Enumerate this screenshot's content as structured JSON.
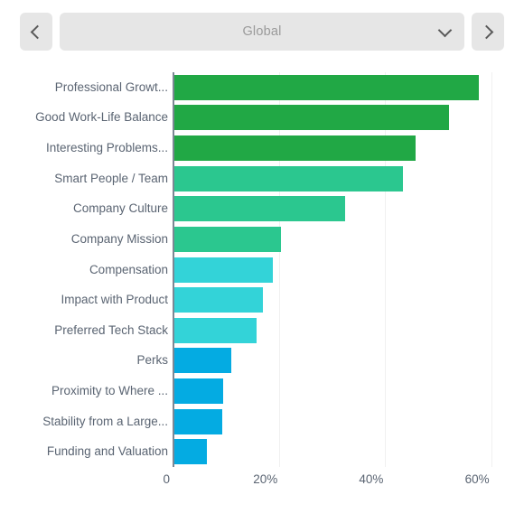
{
  "header": {
    "prev_button_label": "‹",
    "next_button_label": "›",
    "prev_icon": "chevron-left-icon",
    "next_icon": "chevron-right-icon",
    "caret_icon": "chevron-down-icon",
    "select_value": "Global"
  },
  "colors": {
    "green": "#21a845",
    "teal": "#2bc78f",
    "cyan": "#33d3d8",
    "blue": "#04abe2",
    "axis": "#7b8794",
    "gridline": "#f0f0f0",
    "label_text": "#5a6472",
    "control_bg": "#e6e6e6",
    "select_text": "#9a9a9a"
  },
  "chart_data": {
    "type": "bar",
    "orientation": "horizontal",
    "title": "",
    "xlabel": "",
    "ylabel": "",
    "xlim": [
      0,
      66.2
    ],
    "grid": true,
    "legend": "none",
    "xticks": [
      "0",
      "20%",
      "40%",
      "60%"
    ],
    "xtick_values": [
      0,
      20,
      40,
      60
    ],
    "categories": [
      "Professional Growt...",
      "Good Work-Life Balance",
      "Interesting Problems...",
      "Smart People / Team",
      "Company Culture",
      "Company Mission",
      "Compensation",
      "Impact with Product",
      "Preferred Tech Stack",
      "Perks",
      "Proximity to Where ...",
      "Stability from a Large...",
      "Funding and Valuation"
    ],
    "values": [
      57.6,
      52.0,
      45.8,
      43.3,
      32.4,
      20.3,
      18.7,
      16.9,
      15.7,
      10.9,
      9.4,
      9.2,
      6.3
    ],
    "bar_colors": [
      "#21a845",
      "#21a845",
      "#21a845",
      "#2bc78f",
      "#2bc78f",
      "#2bc78f",
      "#33d3d8",
      "#33d3d8",
      "#33d3d8",
      "#04abe2",
      "#04abe2",
      "#04abe2",
      "#04abe2"
    ]
  }
}
